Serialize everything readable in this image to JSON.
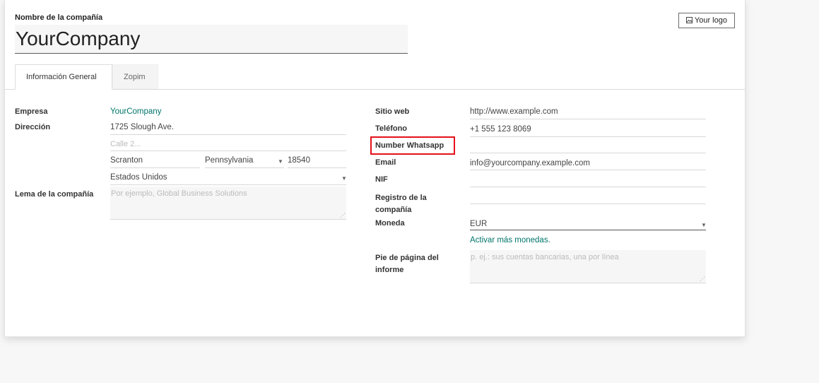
{
  "header": {
    "company_label": "Nombre de la compañía",
    "company_name": "YourCompany",
    "logo_button": "Your logo",
    "logo_icon": "image-icon"
  },
  "tabs": [
    {
      "label": "Información General",
      "active": true
    },
    {
      "label": "Zopim",
      "active": false
    }
  ],
  "left": {
    "empresa_label": "Empresa",
    "empresa_value": "YourCompany",
    "direccion_label": "Dirección",
    "street": "1725 Slough Ave.",
    "street2_placeholder": "Calle 2...",
    "city": "Scranton",
    "state": "Pennsylvania",
    "zip": "18540",
    "country": "Estados Unidos",
    "lema_label": "Lema de la compañía",
    "lema_placeholder": "Por ejemplo, Global Business Solutions"
  },
  "right": {
    "sitio_label": "Sitio web",
    "sitio_value": "http://www.example.com",
    "telefono_label": "Teléfono",
    "telefono_value": "+1 555 123 8069",
    "whatsapp_label": "Number Whatsapp",
    "whatsapp_value": "",
    "email_label": "Email",
    "email_value": "info@yourcompany.example.com",
    "nif_label": "NIF",
    "nif_value": "",
    "registro_label_1": "Registro de la",
    "registro_label_2": "compañía",
    "registro_value": "",
    "moneda_label": "Moneda",
    "moneda_value": "EUR",
    "activar_link": "Activar más monedas.",
    "pie_label_1": "Pie de página del",
    "pie_label_2": "informe",
    "pie_placeholder": "p. ej.: sus cuentas bancarias, una por línea"
  },
  "colors": {
    "link": "#00756a",
    "highlight": "#e5111b"
  }
}
